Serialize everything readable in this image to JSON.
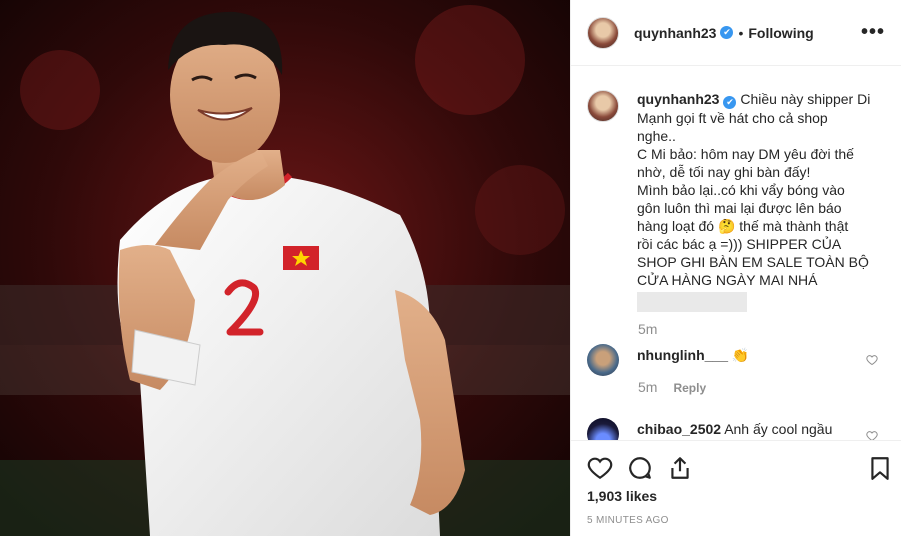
{
  "post": {
    "username": "quynhanh23",
    "verified_mark": "✔",
    "follow_separator": "•",
    "follow_status": "Following",
    "more_label": "•••"
  },
  "caption": {
    "username": "quynhanh23",
    "lines": [
      "Chiều này shipper Di",
      "Mạnh gọi ft về hát cho cả shop",
      "nghe..",
      "C Mi bảo: hôm nay DM yêu đời thế",
      "nhờ, dễ tối nay ghi bàn đấy!",
      "Mình bảo lại..có khi vẩy bóng vào",
      "gôn luôn thì mai lại được lên báo",
      "hàng loạt đó 🤔 thế mà thành thật",
      "rồi các bác ạ =))) SHIPPER CỦA",
      "SHOP GHI BÀN EM SALE TOÀN BỘ",
      "CỬA HÀNG NGÀY MAI NHÁ"
    ],
    "time": "5m"
  },
  "comments": [
    {
      "username": "nhunglinh___",
      "text": "👏",
      "time": "5m",
      "reply_label": "Reply"
    },
    {
      "username": "chibao_2502",
      "text": "Anh ấy cool ngầu"
    }
  ],
  "icons": [
    "heart-icon",
    "comment-icon",
    "share-icon",
    "bookmark-icon",
    "more-icon",
    "verified-icon"
  ],
  "likes": "1,903 likes",
  "timestamp": "5 MINUTES AGO",
  "colors": {
    "verified": "#3897f0",
    "text": "#262626",
    "muted": "#8e8e8e",
    "photo_bg": "#3a0c0c",
    "jersey": "#f4f4f4",
    "jersey_accent": "#d2232a"
  }
}
